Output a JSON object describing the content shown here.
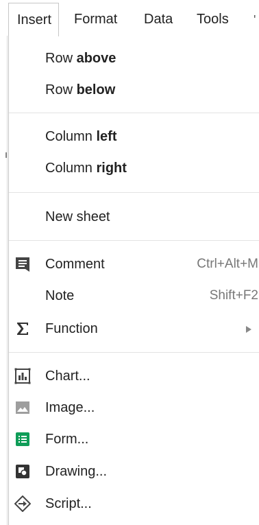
{
  "menubar": {
    "tabs": [
      {
        "label": "Insert"
      },
      {
        "label": "Format"
      },
      {
        "label": "Data"
      },
      {
        "label": "Tools"
      }
    ]
  },
  "insert_menu": {
    "row_above": {
      "prefix": "Row ",
      "bold": "above"
    },
    "row_below": {
      "prefix": "Row ",
      "bold": "below"
    },
    "column_left": {
      "prefix": "Column ",
      "bold": "left"
    },
    "column_right": {
      "prefix": "Column ",
      "bold": "right"
    },
    "new_sheet": {
      "label": "New sheet"
    },
    "comment": {
      "label": "Comment",
      "shortcut": "Ctrl+Alt+M",
      "icon": "comment-icon"
    },
    "note": {
      "label": "Note",
      "shortcut": "Shift+F2"
    },
    "function": {
      "label": "Function",
      "icon": "sigma-icon"
    },
    "chart": {
      "label": "Chart...",
      "icon": "chart-icon"
    },
    "image": {
      "label": "Image...",
      "icon": "image-icon"
    },
    "form": {
      "label": "Form...",
      "icon": "form-icon",
      "color": "#0f9d58"
    },
    "drawing": {
      "label": "Drawing...",
      "icon": "drawing-icon"
    },
    "script": {
      "label": "Script...",
      "icon": "script-icon"
    }
  }
}
